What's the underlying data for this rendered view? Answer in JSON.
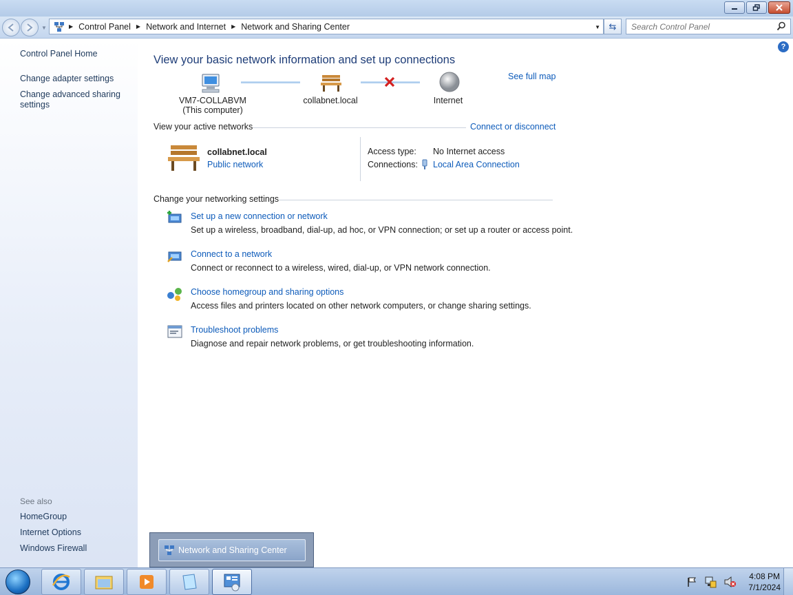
{
  "titlebar": {
    "minimize": "minimize",
    "restore": "restore",
    "close": "close"
  },
  "address": {
    "crumbs": [
      "Control Panel",
      "Network and Internet",
      "Network and Sharing Center"
    ],
    "search_placeholder": "Search Control Panel"
  },
  "sidebar": {
    "home": "Control Panel Home",
    "adapter": "Change adapter settings",
    "advanced_line1": "Change advanced sharing",
    "advanced_line2": "settings",
    "see_also": "See also",
    "homegroup": "HomeGroup",
    "internet_options": "Internet Options",
    "firewall": "Windows Firewall"
  },
  "main": {
    "title": "View your basic network information and set up connections",
    "see_full_map": "See full map",
    "map": {
      "computer_name": "VM7-COLLABVM",
      "computer_note": "(This computer)",
      "network": "collabnet.local",
      "internet": "Internet"
    },
    "active_networks": {
      "heading": "View your active networks",
      "connect_link": "Connect or disconnect",
      "network_name": "collabnet.local",
      "network_type": "Public network",
      "access_label": "Access type:",
      "access_value": "No Internet access",
      "connections_label": "Connections:",
      "connections_value": "Local Area Connection"
    },
    "settings": {
      "heading": "Change your networking settings",
      "tasks": [
        {
          "title": "Set up a new connection or network",
          "desc": "Set up a wireless, broadband, dial-up, ad hoc, or VPN connection; or set up a router or access point."
        },
        {
          "title": "Connect to a network",
          "desc": "Connect or reconnect to a wireless, wired, dial-up, or VPN network connection."
        },
        {
          "title": "Choose homegroup and sharing options",
          "desc": "Access files and printers located on other network computers, or change sharing settings."
        },
        {
          "title": "Troubleshoot problems",
          "desc": "Diagnose and repair network problems, or get troubleshooting information."
        }
      ]
    }
  },
  "thumbnail": {
    "label": "Network and Sharing Center"
  },
  "taskbar": {
    "time": "4:08 PM",
    "date": "7/1/2024"
  }
}
